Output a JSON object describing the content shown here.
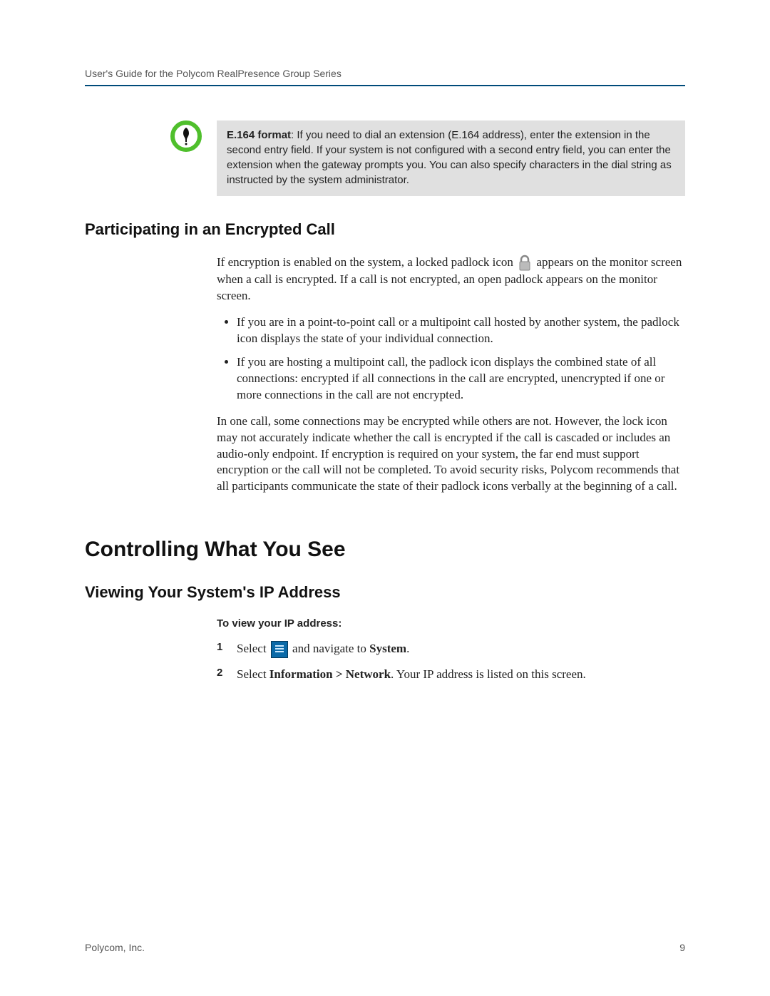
{
  "header": "User's Guide for the Polycom RealPresence Group Series",
  "note": {
    "strong": "E.164 format",
    "text": ": If you need to dial an extension (E.164 address), enter the extension in the second entry field. If your system is not configured with a second entry field, you can enter the extension when the gateway prompts you. You can also specify characters in the dial string as instructed by the system administrator."
  },
  "section1": {
    "title": "Participating in an Encrypted Call",
    "intro_pre": "If encryption is enabled on the system, a locked padlock icon ",
    "intro_post": " appears on the monitor screen when a call is encrypted. If a call is not encrypted, an open padlock appears on the monitor screen.",
    "bullets": [
      "If you are in a point-to-point call or a multipoint call hosted by another system, the padlock icon displays the state of your individual connection.",
      "If you are hosting a multipoint call, the padlock icon displays the combined state of all connections: encrypted if all connections in the call are encrypted, unencrypted if one or more connections in the call are not encrypted."
    ],
    "para2": "In one call, some connections may be encrypted while others are not. However, the lock icon may not accurately indicate whether the call is encrypted if the call is cascaded or includes an audio-only endpoint. If encryption is required on your system, the far end must support encryption or the call will not be completed. To avoid security risks, Polycom recommends that all participants communicate the state of their padlock icons verbally at the beginning of a call."
  },
  "main_heading": "Controlling What You See",
  "section2": {
    "title": "Viewing Your System's IP Address",
    "sub": "To view your IP address:",
    "step1_pre": "Select ",
    "step1_mid": " and navigate to ",
    "step1_bold": "System",
    "step1_post": ".",
    "step2_pre": "Select ",
    "step2_bold": "Information > Network",
    "step2_post": ". Your IP address is listed on this screen."
  },
  "footer": {
    "left": "Polycom, Inc.",
    "right": "9"
  }
}
